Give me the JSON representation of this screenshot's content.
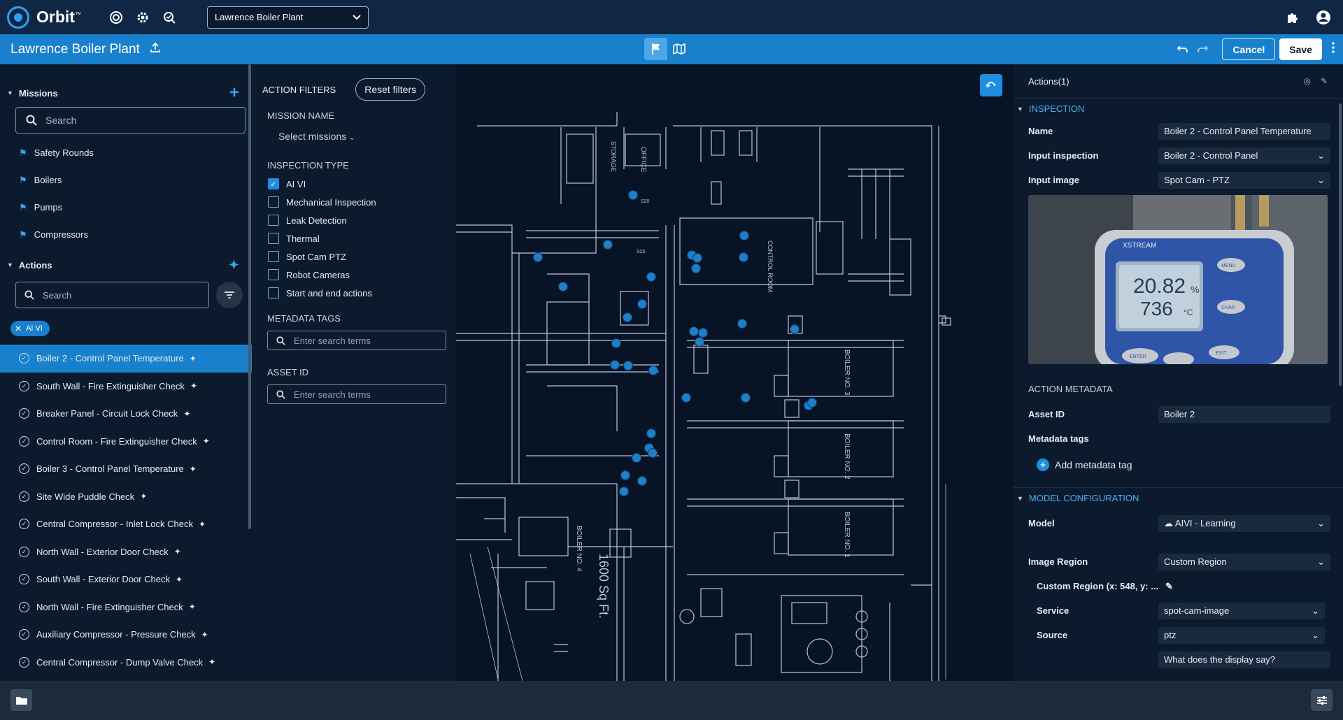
{
  "app": {
    "name": "Orbit",
    "trademark": "™"
  },
  "topbar": {
    "plant_select": "Lawrence Boiler Plant",
    "icons": [
      "spot-icon",
      "gear-icon",
      "search-check-icon",
      "puzzle-icon",
      "account-icon"
    ]
  },
  "subbar": {
    "title": "Lawrence Boiler Plant",
    "cancel_label": "Cancel",
    "save_label": "Save"
  },
  "missions": {
    "header": "Missions",
    "search_placeholder": "Search",
    "items": [
      {
        "label": "Safety Rounds"
      },
      {
        "label": "Boilers"
      },
      {
        "label": "Pumps"
      },
      {
        "label": "Compressors"
      }
    ]
  },
  "actions": {
    "header": "Actions",
    "search_placeholder": "Search",
    "chip": "AI VI",
    "items": [
      {
        "label": "Boiler 2 - Control Panel Temperature",
        "selected": true
      },
      {
        "label": "South Wall - Fire Extinguisher Check"
      },
      {
        "label": "Breaker Panel - Circuit Lock Check"
      },
      {
        "label": "Control Room - Fire Extinguisher Check"
      },
      {
        "label": "Boiler 3 - Control Panel Temperature"
      },
      {
        "label": "Site Wide Puddle Check"
      },
      {
        "label": "Central Compressor - Inlet Lock Check"
      },
      {
        "label": "North Wall - Exterior Door Check"
      },
      {
        "label": "South Wall - Exterior Door Check"
      },
      {
        "label": "North Wall - Fire Extinguisher Check"
      },
      {
        "label": "Auxiliary Compressor - Pressure Check"
      },
      {
        "label": "Central Compressor - Dump Valve Check"
      }
    ]
  },
  "filters": {
    "title": "ACTION FILTERS",
    "reset_label": "Reset filters",
    "mission_name_label": "MISSION NAME",
    "mission_select": "Select missions",
    "inspection_type_label": "INSPECTION TYPE",
    "inspection_types": [
      {
        "label": "AI VI",
        "checked": true
      },
      {
        "label": "Mechanical Inspection",
        "checked": false
      },
      {
        "label": "Leak Detection",
        "checked": false
      },
      {
        "label": "Thermal",
        "checked": false
      },
      {
        "label": "Spot Cam PTZ",
        "checked": false
      },
      {
        "label": "Robot Cameras",
        "checked": false
      },
      {
        "label": "Start and end actions",
        "checked": false
      }
    ],
    "metadata_tags_label": "METADATA TAGS",
    "metadata_placeholder": "Enter search terms",
    "asset_id_label": "ASSET ID",
    "asset_placeholder": "Enter search terms"
  },
  "map": {
    "room_labels": [
      "OFFICE",
      "STORAGE",
      "CONTROL ROOM",
      "BOILER NO. 3",
      "BOILER NO. 2",
      "BOILER NO. 1",
      "BOILER NO. 4",
      "1600 Sq Ft."
    ],
    "waypoint_labels": [
      "S20",
      "S25"
    ]
  },
  "panel": {
    "actions_title": "Actions",
    "actions_count": "(1)",
    "inspection_section": "INSPECTION",
    "name_label": "Name",
    "name_value": "Boiler 2 - Control Panel Temperature",
    "input_inspection_label": "Input inspection",
    "input_inspection_value": "Boiler 2 - Control Panel",
    "input_image_label": "Input image",
    "input_image_value": "Spot Cam - PTZ",
    "device": {
      "brand": "XSTREAM",
      "reading_1": "20.82",
      "unit_1": "%",
      "reading_2": "736",
      "unit_2": "°C",
      "btn_menu": "MENU",
      "btn_char": "CHAR",
      "btn_enter": "ENTER",
      "btn_exit": "EXIT"
    },
    "action_metadata_section": "ACTION METADATA",
    "asset_id_label": "Asset ID",
    "asset_id_value": "Boiler 2",
    "metadata_tags_label": "Metadata tags",
    "add_tag_label": "Add metadata tag",
    "model_section": "MODEL CONFIGURATION",
    "model_label": "Model",
    "model_value": "AIVI - Learning",
    "image_region_label": "Image Region",
    "image_region_value": "Custom Region",
    "custom_region_label": "Custom Region (x: 548, y: ...",
    "service_label": "Service",
    "service_value": "spot-cam-image",
    "source_label": "Source",
    "source_value": "ptz",
    "question_value": "What does the display say?"
  },
  "colors": {
    "topbar": "#0f2744",
    "accent": "#1880cc",
    "panel": "#0c1a2e",
    "map_bg": "#081326",
    "map_lines": "#b8c7d8",
    "waypoint": "#1f7fc8"
  }
}
